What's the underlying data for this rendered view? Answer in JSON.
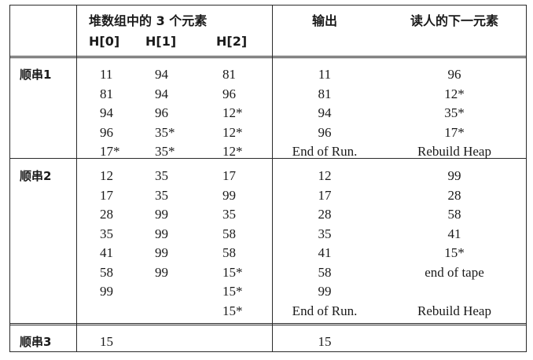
{
  "header": {
    "heap_title": "堆数组中的 3 个元素",
    "h0": "H[0]",
    "h1": "H[1]",
    "h2": "H[2]",
    "output": "输出",
    "next": "读人的下一元素"
  },
  "runs": [
    {
      "label": "顺串1",
      "rows": [
        {
          "h0": "11",
          "h1": "94",
          "h2": "81",
          "out": "11",
          "next": "96"
        },
        {
          "h0": "81",
          "h1": "94",
          "h2": "96",
          "out": "81",
          "next": "12*"
        },
        {
          "h0": "94",
          "h1": "96",
          "h2": "12*",
          "out": "94",
          "next": "35*"
        },
        {
          "h0": "96",
          "h1": "35*",
          "h2": "12*",
          "out": "96",
          "next": "17*"
        },
        {
          "h0": "17*",
          "h1": "35*",
          "h2": "12*",
          "out": "End of Run.",
          "next": "Rebuild Heap"
        }
      ]
    },
    {
      "label": "顺串2",
      "rows": [
        {
          "h0": "12",
          "h1": "35",
          "h2": "17",
          "out": "12",
          "next": "99"
        },
        {
          "h0": "17",
          "h1": "35",
          "h2": "99",
          "out": "17",
          "next": "28"
        },
        {
          "h0": "28",
          "h1": "99",
          "h2": "35",
          "out": "28",
          "next": "58"
        },
        {
          "h0": "35",
          "h1": "99",
          "h2": "58",
          "out": "35",
          "next": "41"
        },
        {
          "h0": "41",
          "h1": "99",
          "h2": "58",
          "out": "41",
          "next": "15*"
        },
        {
          "h0": "58",
          "h1": "99",
          "h2": "15*",
          "out": "58",
          "next": "end of tape"
        },
        {
          "h0": "99",
          "h1": "",
          "h2": "15*",
          "out": "99",
          "next": ""
        },
        {
          "h0": "",
          "h1": "",
          "h2": "15*",
          "out": "End of Run.",
          "next": "Rebuild Heap"
        }
      ]
    },
    {
      "label": "顺串3",
      "rows": [
        {
          "h0": "15",
          "h1": "",
          "h2": "",
          "out": "15",
          "next": ""
        }
      ]
    }
  ]
}
